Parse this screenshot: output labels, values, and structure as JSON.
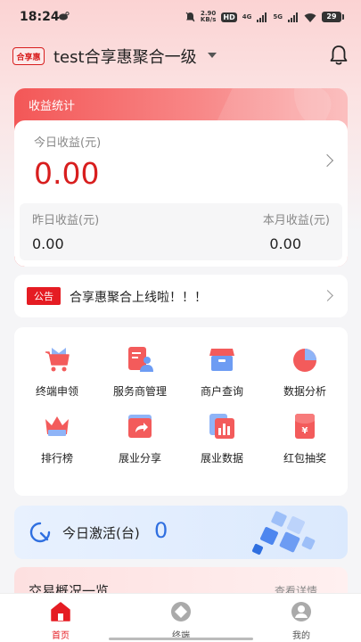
{
  "status_bar": {
    "time": "18:24",
    "speed_value": "2.90",
    "speed_unit": "KB/s",
    "hd_badge": "HD",
    "net_type": "4G",
    "net_type2": "5G",
    "battery": "29"
  },
  "header": {
    "logo_text": "合享惠",
    "org_name": "test合享惠聚合一级"
  },
  "income": {
    "section_title": "收益统计",
    "today_label": "今日收益(元)",
    "today_value": "0.00",
    "yesterday_label": "昨日收益(元)",
    "yesterday_value": "0.00",
    "month_label": "本月收益(元)",
    "month_value": "0.00"
  },
  "notice": {
    "tag": "公告",
    "text": "合享惠聚合上线啦！！！"
  },
  "grid": {
    "items": [
      {
        "label": "终端申领",
        "icon": "cart-icon"
      },
      {
        "label": "服务商管理",
        "icon": "merchant-manage-icon"
      },
      {
        "label": "商户查询",
        "icon": "shop-icon"
      },
      {
        "label": "数据分析",
        "icon": "pie-chart-icon"
      },
      {
        "label": "排行榜",
        "icon": "crown-icon"
      },
      {
        "label": "展业分享",
        "icon": "share-icon"
      },
      {
        "label": "展业数据",
        "icon": "bar-chart-icon"
      },
      {
        "label": "红包抽奖",
        "icon": "red-envelope-icon"
      }
    ]
  },
  "activation": {
    "label": "今日激活(台)",
    "value": "0"
  },
  "trade": {
    "title": "交易概况一览",
    "more": "查看详情"
  },
  "bottom_nav": {
    "items": [
      {
        "label": "首页",
        "active": true
      },
      {
        "label": "终端",
        "active": false
      },
      {
        "label": "我的",
        "active": false
      }
    ]
  },
  "colors": {
    "brand_red": "#e51c23",
    "accent_blue": "#2f6fe0"
  }
}
